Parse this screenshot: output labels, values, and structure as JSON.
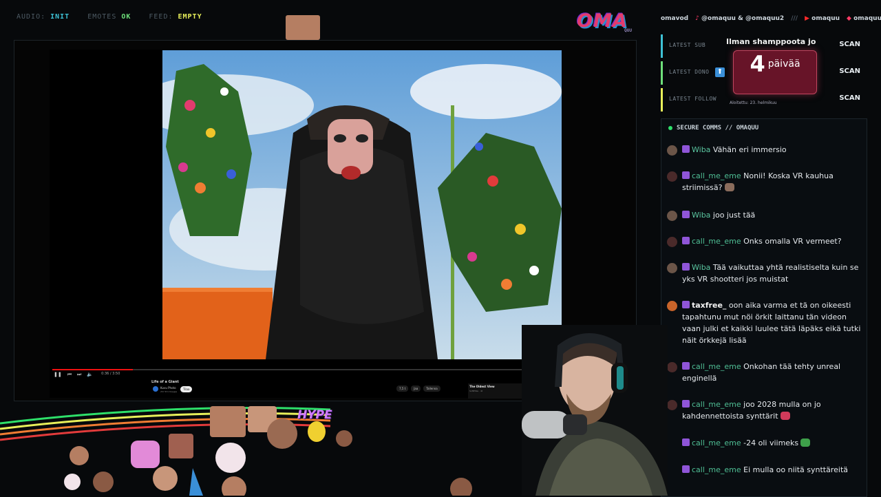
{
  "status_bar": {
    "audio_label": "AUDIO:",
    "audio_value": "INIT",
    "emotes_label": "EMOTES",
    "emotes_value": "OK",
    "feed_label": "FEED:",
    "feed_value": "EMPTY"
  },
  "logo": {
    "text": "OMA",
    "sub": "QUU"
  },
  "player": {
    "progress": 0.16,
    "time": "0:36 / 3:50",
    "video_title": "Life of a Giant",
    "channel": "Kuvu Photo",
    "subscribers": "257 M ti tilaajaa",
    "subscribe_label": "Tilaa",
    "actions": [
      "7,5 t",
      "Jaa",
      "Tallenna"
    ],
    "up_next_title": "The Oldest View",
    "up_next_channel": "SoftPhile · 4t"
  },
  "socials": {
    "items": [
      "omavod",
      "@omaquu & @omaquu2",
      "///",
      "omaquu",
      "omaquu"
    ]
  },
  "latest": [
    {
      "label": "LATEST SUB",
      "value": "SCAN",
      "color": "#3ec2d6"
    },
    {
      "label": "LATEST DONO",
      "value": "SCAN",
      "color": "#6ee07a"
    },
    {
      "label": "LATEST FOLLOW",
      "value": "SCAN",
      "color": "#e8f05a"
    }
  ],
  "countdown": {
    "title": "Ilman shamppoota jo",
    "number": "4",
    "unit": "päivää",
    "since": "Aloitettu: 23. helmikuu"
  },
  "chat": {
    "header": "SECURE COMMS // OMAQUU",
    "messages": [
      {
        "user": "Wiba",
        "text": "Vähän eri immersio"
      },
      {
        "user": "call_me_eme",
        "text": "Nonii! Koska VR kauhua striimissä?"
      },
      {
        "user": "Wiba",
        "text": "joo just tää"
      },
      {
        "user": "call_me_eme",
        "text": "Onks omalla VR vermeet?"
      },
      {
        "user": "Wiba",
        "text": "Tää vaikuttaa yhtä realistiselta kuin se yks VR shootteri jos muistat"
      },
      {
        "user": "taxfree_",
        "text": "oon aika varma et tä on oikeesti tapahtunu mut nöi örkit laittanu tän videon vaan julki et kaikki luulee tätä läpäks eikä tutki näit örkkejä lisää"
      },
      {
        "user": "call_me_eme",
        "text": "Onkohan tää tehty unreal enginellä"
      },
      {
        "user": "call_me_eme",
        "text": "joo 2028 mulla on jo kahdennettoista synttärit"
      },
      {
        "user": "call_me_eme",
        "text": "-24 oli viimeks"
      },
      {
        "user": "call_me_eme",
        "text": "Ei mulla oo niitä synttäreitä"
      }
    ]
  },
  "overlay": {
    "hype_text": "HYPE"
  },
  "colors": {
    "accent_pink": "#e23b6d",
    "chat_user": "#4fbf95",
    "live_dot": "#2ee06a"
  }
}
